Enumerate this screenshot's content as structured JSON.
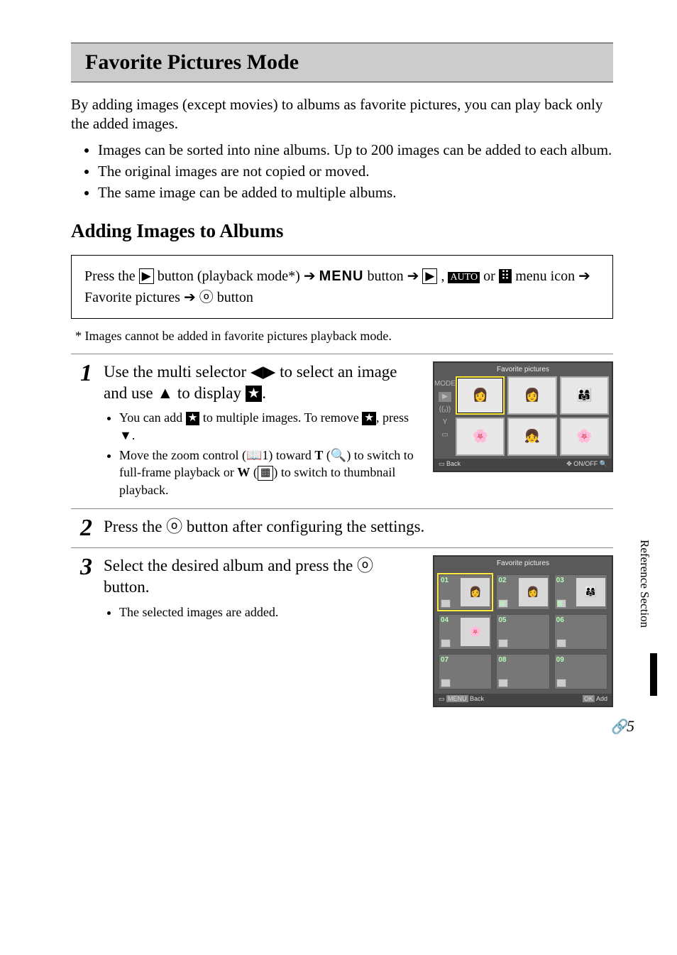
{
  "title": "Favorite Pictures Mode",
  "intro": "By adding images (except movies) to albums as favorite pictures, you can play back only the added images.",
  "bullets": [
    "Images can be sorted into nine albums. Up to 200 images can be added to each album.",
    "The original images are not copied or moved.",
    "The same image can be added to multiple albums."
  ],
  "subhead": "Adding Images to Albums",
  "navbox": {
    "text_a": "Press the ",
    "text_b": " button (playback mode*) ",
    "menu": "MENU",
    "text_c": " button ",
    "text_d": " , ",
    "text_e": " or ",
    "text_f": " menu icon ",
    "text_g": " Favorite pictures ",
    "text_h": " button"
  },
  "footnote": "*   Images cannot be added in favorite pictures playback mode.",
  "steps": {
    "s1": {
      "num": "1",
      "title_a": "Use the multi selector ",
      "title_b": " to select an image and use ",
      "title_c": " to display ",
      "title_d": ".",
      "b1_a": "You can add ",
      "b1_b": " to multiple images. To remove ",
      "b1_c": ", press ",
      "b1_d": ".",
      "b2_a": "Move the zoom control (",
      "b2_ref": "1",
      "b2_b": ") toward ",
      "b2_T": "T",
      "b2_c": " (",
      "b2_d": ") to switch to full-frame playback or ",
      "b2_W": "W",
      "b2_e": " (",
      "b2_f": ") to switch to thumbnail playback."
    },
    "s2": {
      "num": "2",
      "title_a": "Press the ",
      "title_b": " button after configuring the settings."
    },
    "s3": {
      "num": "3",
      "title_a": "Select the desired album and press the ",
      "title_b": " button.",
      "b1": "The selected images are added."
    }
  },
  "screen1": {
    "title": "Favorite pictures",
    "side": {
      "mode": "MODE"
    },
    "footer_left": "Back",
    "footer_right": "ON/OFF"
  },
  "screen2": {
    "title": "Favorite pictures",
    "cells": [
      "01",
      "02",
      "03",
      "04",
      "05",
      "06",
      "07",
      "08",
      "09"
    ],
    "footer_left": "Back",
    "footer_right": "Add"
  },
  "side_tab": "Reference Section",
  "page_number": "5"
}
